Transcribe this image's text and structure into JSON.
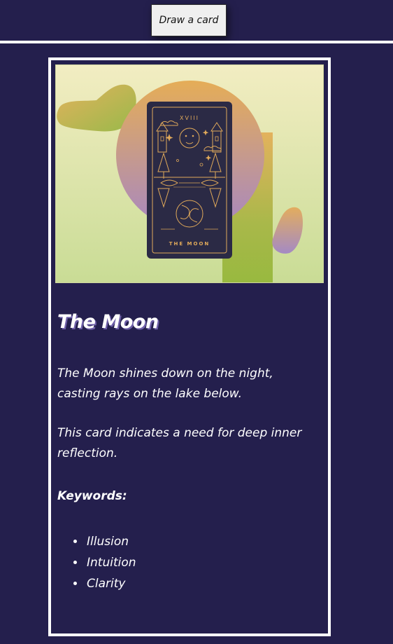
{
  "header": {
    "draw_button_label": "Draw a card"
  },
  "card": {
    "image": {
      "numeral": "XVIII",
      "caption": "THE MOON"
    },
    "title": "The Moon",
    "description": [
      "The Moon shines down on the night, casting rays on the lake below.",
      "This card indicates a need for deep inner reflection."
    ],
    "keywords_heading": "Keywords:",
    "keywords": [
      "Illusion",
      "Intuition",
      "Clarity"
    ]
  },
  "colors": {
    "background": "#241f4d",
    "card_gold": "#e0a95a",
    "tarot_card_bg": "#2b2a45"
  }
}
